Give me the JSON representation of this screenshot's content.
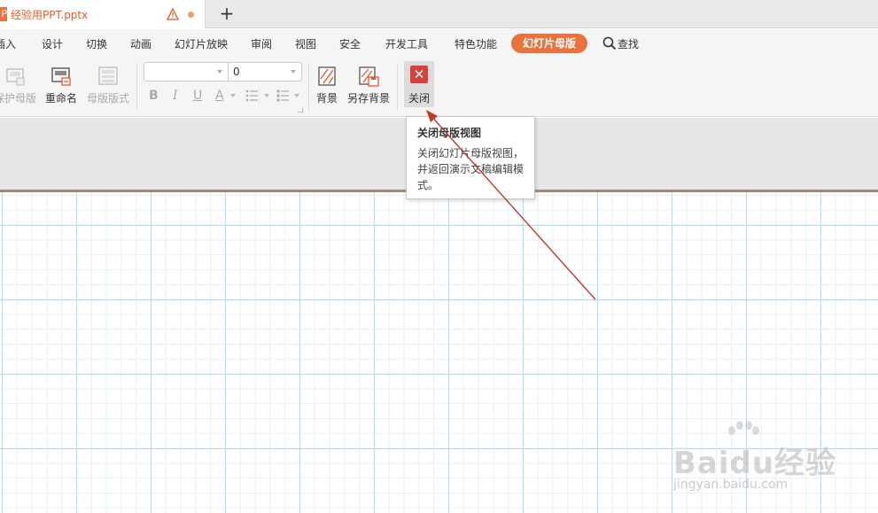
{
  "window": {
    "doc_title": "经验用PPT.pptx",
    "app_badge": "P",
    "new_tab": "+"
  },
  "menu": {
    "items": [
      "插入",
      "设计",
      "切换",
      "动画",
      "幻灯片放映",
      "审阅",
      "视图",
      "安全",
      "开发工具",
      "特色功能"
    ],
    "active": "幻灯片母版",
    "search": "查找"
  },
  "ribbon": {
    "protect_master": "保护母版",
    "rename": "重命名",
    "master_layout": "母版版式",
    "font_name": "",
    "font_size": "0",
    "bold": "B",
    "italic": "I",
    "underline": "U",
    "font_color": "A",
    "background": "背景",
    "save_background": "另存背景",
    "close": "关闭",
    "close_glyph": "✕"
  },
  "tooltip": {
    "title": "关闭母版视图",
    "body": "关闭幻灯片母版视图，并返回演示文稿编辑模式。"
  },
  "watermark": {
    "brand": "Baidu经验",
    "url": "jingyan.baidu.com"
  },
  "colors": {
    "accent": "#e8733f",
    "close_red": "#d9403a",
    "arrow_red": "#c0392b"
  }
}
